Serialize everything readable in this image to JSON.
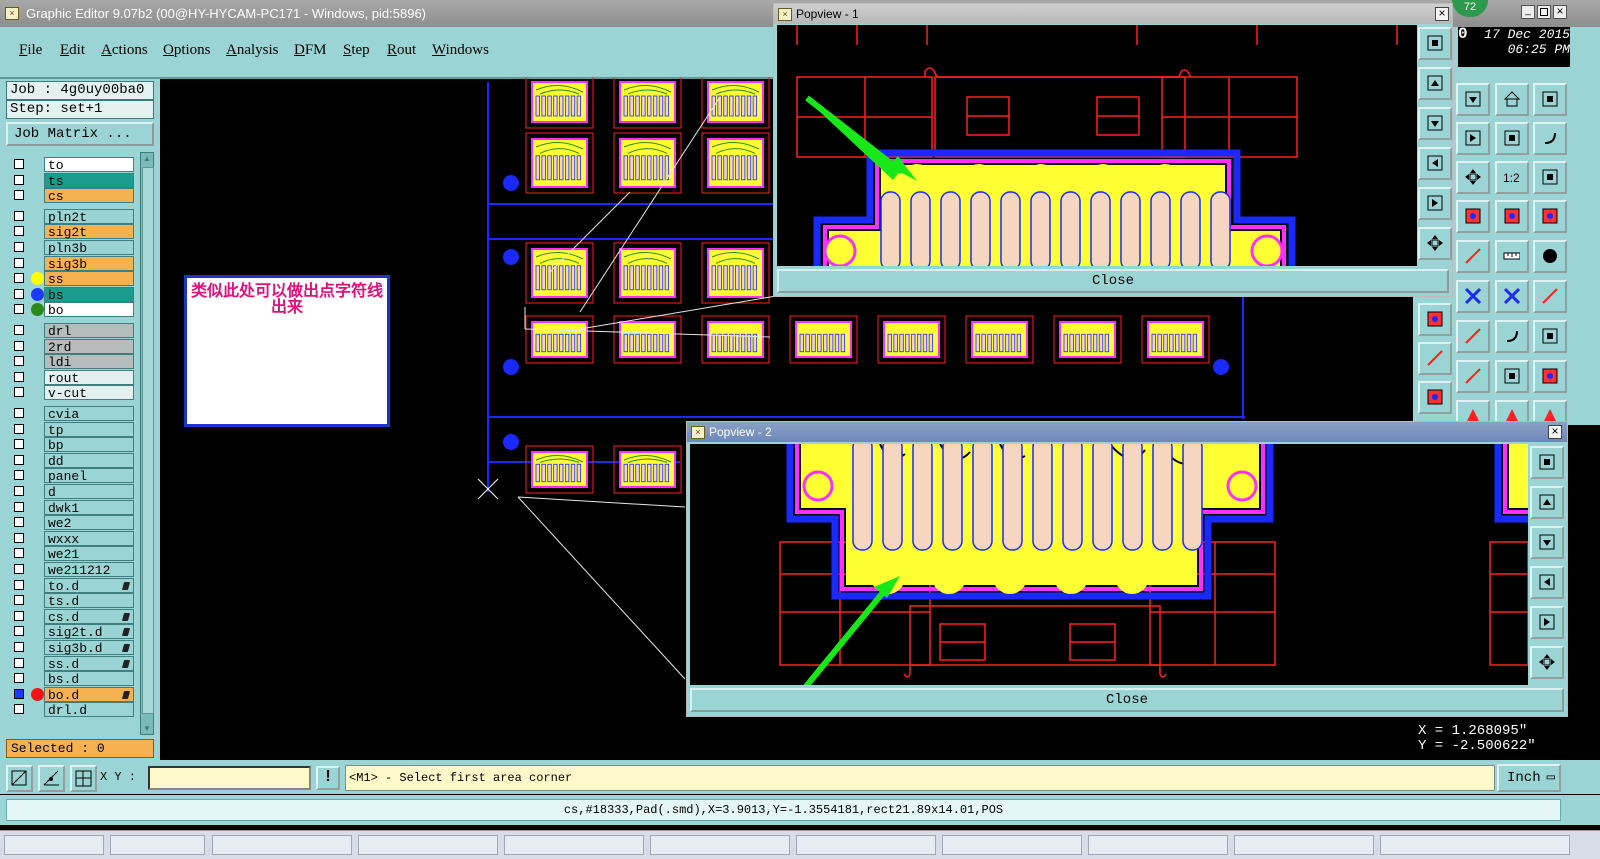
{
  "window": {
    "title": "Graphic Editor 9.07b2 (00@HY-HYCAM-PC171 - Windows, pid:5896)"
  },
  "menu": [
    {
      "label": "File",
      "key": "F",
      "rest": "ile"
    },
    {
      "label": "Edit",
      "key": "E",
      "rest": "dit"
    },
    {
      "label": "Actions",
      "key": "A",
      "rest": "ctions"
    },
    {
      "label": "Options",
      "key": "O",
      "rest": "ptions"
    },
    {
      "label": "Analysis",
      "key": "A",
      "rest": "nalysis"
    },
    {
      "label": "DFM",
      "key": "D",
      "rest": "FM"
    },
    {
      "label": "Step",
      "key": "S",
      "rest": "tep"
    },
    {
      "label": "Rout",
      "key": "R",
      "rest": "out"
    },
    {
      "label": "Windows",
      "key": "W",
      "rest": "indows"
    }
  ],
  "job": {
    "label": "Job : 4g0uy00ba0",
    "step": "Step: set+1",
    "matrix_button": "Job Matrix ..."
  },
  "layers": [
    {
      "name": "to",
      "bg": "#ffffff",
      "dot": ""
    },
    {
      "name": "ts",
      "bg": "#1a9c8c",
      "dot": ""
    },
    {
      "name": "cs",
      "bg": "#f6b250",
      "dot": ""
    },
    {
      "name": "pln2t",
      "bg": "#9bd4d4",
      "dot": ""
    },
    {
      "name": "sig2t",
      "bg": "#f6b250",
      "dot": ""
    },
    {
      "name": "pln3b",
      "bg": "#9bd4d4",
      "dot": ""
    },
    {
      "name": "sig3b",
      "bg": "#f6b250",
      "dot": ""
    },
    {
      "name": "ss",
      "bg": "#f6b250",
      "dot": "#ffff00"
    },
    {
      "name": "bs",
      "bg": "#1a9c8c",
      "dot": "#1a3cff"
    },
    {
      "name": "bo",
      "bg": "#ffffff",
      "dot": "#2c8a1a"
    },
    {
      "name": "drl",
      "bg": "#b4bcbc",
      "dot": ""
    },
    {
      "name": "2rd",
      "bg": "#b4bcbc",
      "dot": ""
    },
    {
      "name": "ldi",
      "bg": "#b4bcbc",
      "dot": ""
    },
    {
      "name": "rout",
      "bg": "#e4f0f0",
      "dot": ""
    },
    {
      "name": "v-cut",
      "bg": "#e4f0f0",
      "dot": ""
    },
    {
      "name": "cvia",
      "bg": "#9bd4d4",
      "dot": ""
    },
    {
      "name": "tp",
      "bg": "#9bd4d4",
      "dot": ""
    },
    {
      "name": "bp",
      "bg": "#9bd4d4",
      "dot": ""
    },
    {
      "name": "dd",
      "bg": "#9bd4d4",
      "dot": ""
    },
    {
      "name": "panel",
      "bg": "#9bd4d4",
      "dot": ""
    },
    {
      "name": "d",
      "bg": "#9bd4d4",
      "dot": ""
    },
    {
      "name": "dwk1",
      "bg": "#9bd4d4",
      "dot": ""
    },
    {
      "name": "we2",
      "bg": "#9bd4d4",
      "dot": ""
    },
    {
      "name": "wxxx",
      "bg": "#9bd4d4",
      "dot": ""
    },
    {
      "name": "we21",
      "bg": "#9bd4d4",
      "dot": ""
    },
    {
      "name": "we211212",
      "bg": "#9bd4d4",
      "dot": ""
    },
    {
      "name": "to.d",
      "bg": "#9bd4d4",
      "dot": ""
    },
    {
      "name": "ts.d",
      "bg": "#9bd4d4",
      "dot": ""
    },
    {
      "name": "cs.d",
      "bg": "#9bd4d4",
      "dot": ""
    },
    {
      "name": "sig2t.d",
      "bg": "#9bd4d4",
      "dot": ""
    },
    {
      "name": "sig3b.d",
      "bg": "#9bd4d4",
      "dot": ""
    },
    {
      "name": "ss.d",
      "bg": "#9bd4d4",
      "dot": ""
    },
    {
      "name": "bs.d",
      "bg": "#9bd4d4",
      "dot": ""
    },
    {
      "name": "bo.d",
      "bg": "#f6b250",
      "dot": "#ff1010"
    },
    {
      "name": "drl.d",
      "bg": "#9bd4d4",
      "dot": ""
    }
  ],
  "selected": "Selected : 0",
  "annotation": {
    "text": "类似此处可以做出点字符线出来"
  },
  "popview1": {
    "title": "Popview - 1",
    "close": "Close"
  },
  "popview2": {
    "title": "Popview - 2",
    "close": "Close"
  },
  "badge": "72",
  "clock": {
    "date": "17 Dec 2015",
    "time": "06:25 PM",
    "prefix": "0"
  },
  "cursor_coords": {
    "x": "X = 1.268095\"",
    "y": "Y = -2.500622\""
  },
  "toolbar_right": {
    "zoom_label": "1:2"
  },
  "command": {
    "xy_label": "X Y :",
    "xy_value": "",
    "message": "<M1> - Select first area corner",
    "unit": "Inch"
  },
  "status": "cs,#18333,Pad(.smd),X=3.9013,Y=-1.3554181,rect21.89x14.01,POS",
  "colors": {
    "panel": "#9bd4d4",
    "pad": "#f6d6c0",
    "soldermask": "#ff30ff",
    "silk": "#ffff33",
    "outline": "#ff2020",
    "board": "#1a2aff"
  }
}
